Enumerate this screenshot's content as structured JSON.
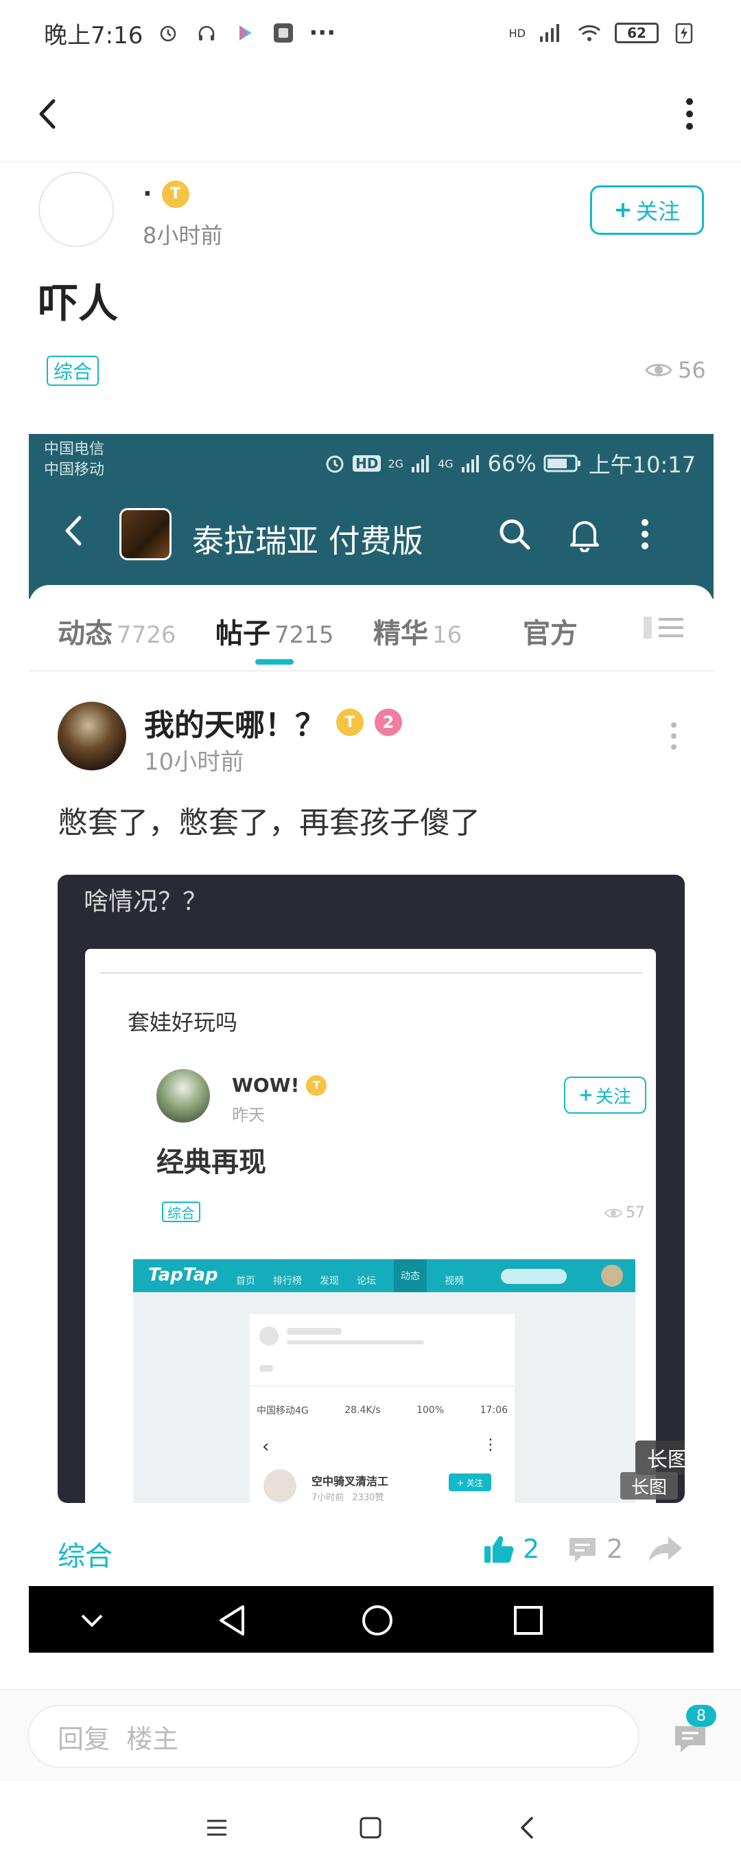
{
  "status_bar": {
    "time": "晚上7:16",
    "more": "···",
    "network": "HD",
    "battery": "62"
  },
  "post": {
    "author_name": "·",
    "author_badge": "T",
    "time": "8小时前",
    "follow_label": "关注",
    "title": "吓人",
    "tag": "综合",
    "views": "56"
  },
  "embedded": {
    "carrier_1": "中国电信",
    "carrier_2": "中国移动",
    "status_network": "HD",
    "status_signal_1": "2G",
    "status_signal_2": "4G",
    "battery": "66%",
    "time": "上午10:17",
    "game_title": "泰拉瑞亚 付费版",
    "tabs": [
      {
        "label": "动态",
        "count": "7726"
      },
      {
        "label": "帖子",
        "count": "7215"
      },
      {
        "label": "精华",
        "count": "16"
      },
      {
        "label": "官方",
        "count": ""
      }
    ],
    "post_user": "我的天哪！？",
    "post_user_badge": "T",
    "post_user_level": "2",
    "post_time": "10小时前",
    "post_text": "憋套了，憋套了，再套孩子傻了",
    "image_caption": "啥情况？？",
    "inner": {
      "title": "套娃好玩吗",
      "user": "WOW!",
      "badge": "T",
      "time": "昨天",
      "follow_label": "关注",
      "post_title": "经典再现",
      "tag": "综合",
      "views": "57",
      "web_logo": "TapTap",
      "web_nav": [
        "首页",
        "排行榜",
        "发现",
        "论坛",
        "动态",
        "视频"
      ],
      "phone_carrier": "中国移动4G",
      "phone_speed": "28.4K/s",
      "phone_battery": "100%",
      "phone_time": "17:06",
      "phone_user": "空中骑叉清洁工",
      "phone_time_ago": "7小时前",
      "phone_sub": "2330赞",
      "phone_follow": "+ 关注"
    },
    "long_image_label": "长图",
    "long_image_label_2": "长图",
    "foot_tag": "综合",
    "likes": "2",
    "comments": "2"
  },
  "reply": {
    "placeholder": "回复  楼主",
    "badge": "8"
  },
  "colors": {
    "accent": "#14b9c8",
    "embedded_header": "#23606f",
    "badge_gold": "#f6c343"
  }
}
